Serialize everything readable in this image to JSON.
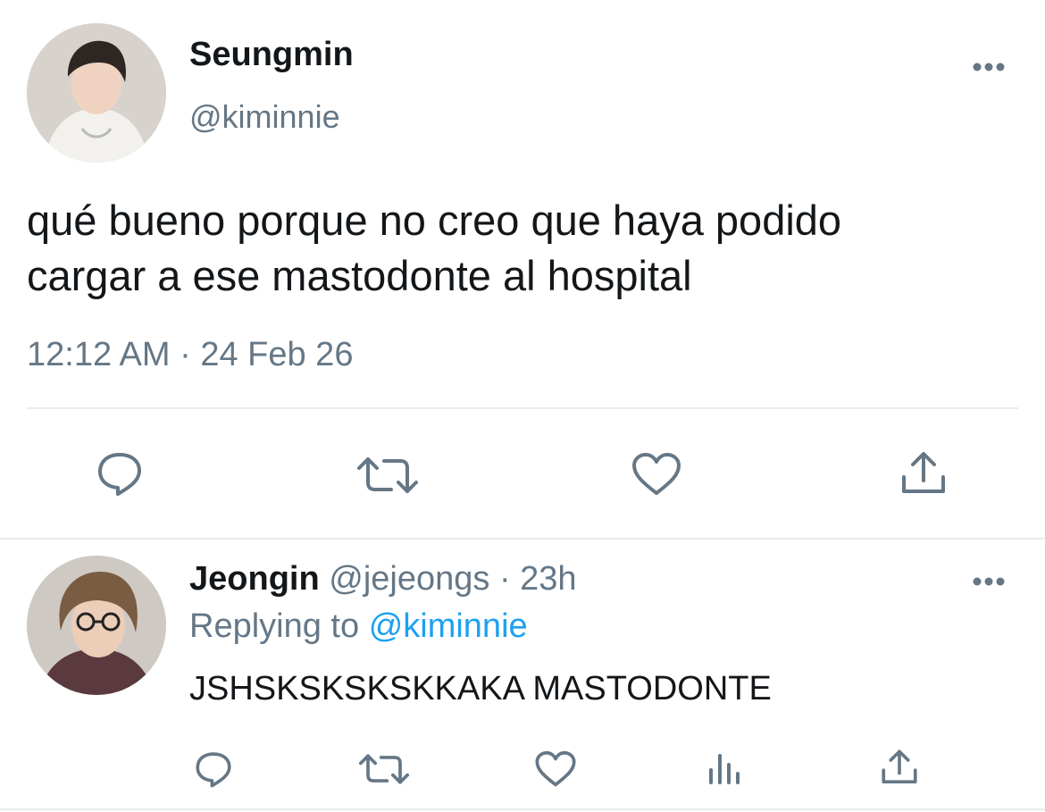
{
  "main_tweet": {
    "display_name": "Seungmin",
    "handle": "@kiminnie",
    "text_line1": "qué bueno porque no creo que haya podido",
    "text_line2": "cargar a ese mastodonte al hospital",
    "timestamp": "12:12 AM · 24 Feb 26",
    "actions": [
      "reply-icon",
      "retweet-icon",
      "like-icon",
      "share-icon"
    ]
  },
  "reply": {
    "display_name": "Jeongin",
    "handle": "@jejeongs",
    "time": "· 23h",
    "replying_prefix": "Replying to",
    "replying_handle": "@kiminnie",
    "text": "JSHSKSKSKSKKAKA MASTODONTE",
    "actions": [
      "reply-icon",
      "retweet-icon",
      "like-icon",
      "analytics-icon",
      "share-icon"
    ]
  },
  "colors": {
    "text": "#14171a",
    "secondary": "#657786",
    "link": "#1da1f2",
    "divider": "#e6ecf0"
  }
}
